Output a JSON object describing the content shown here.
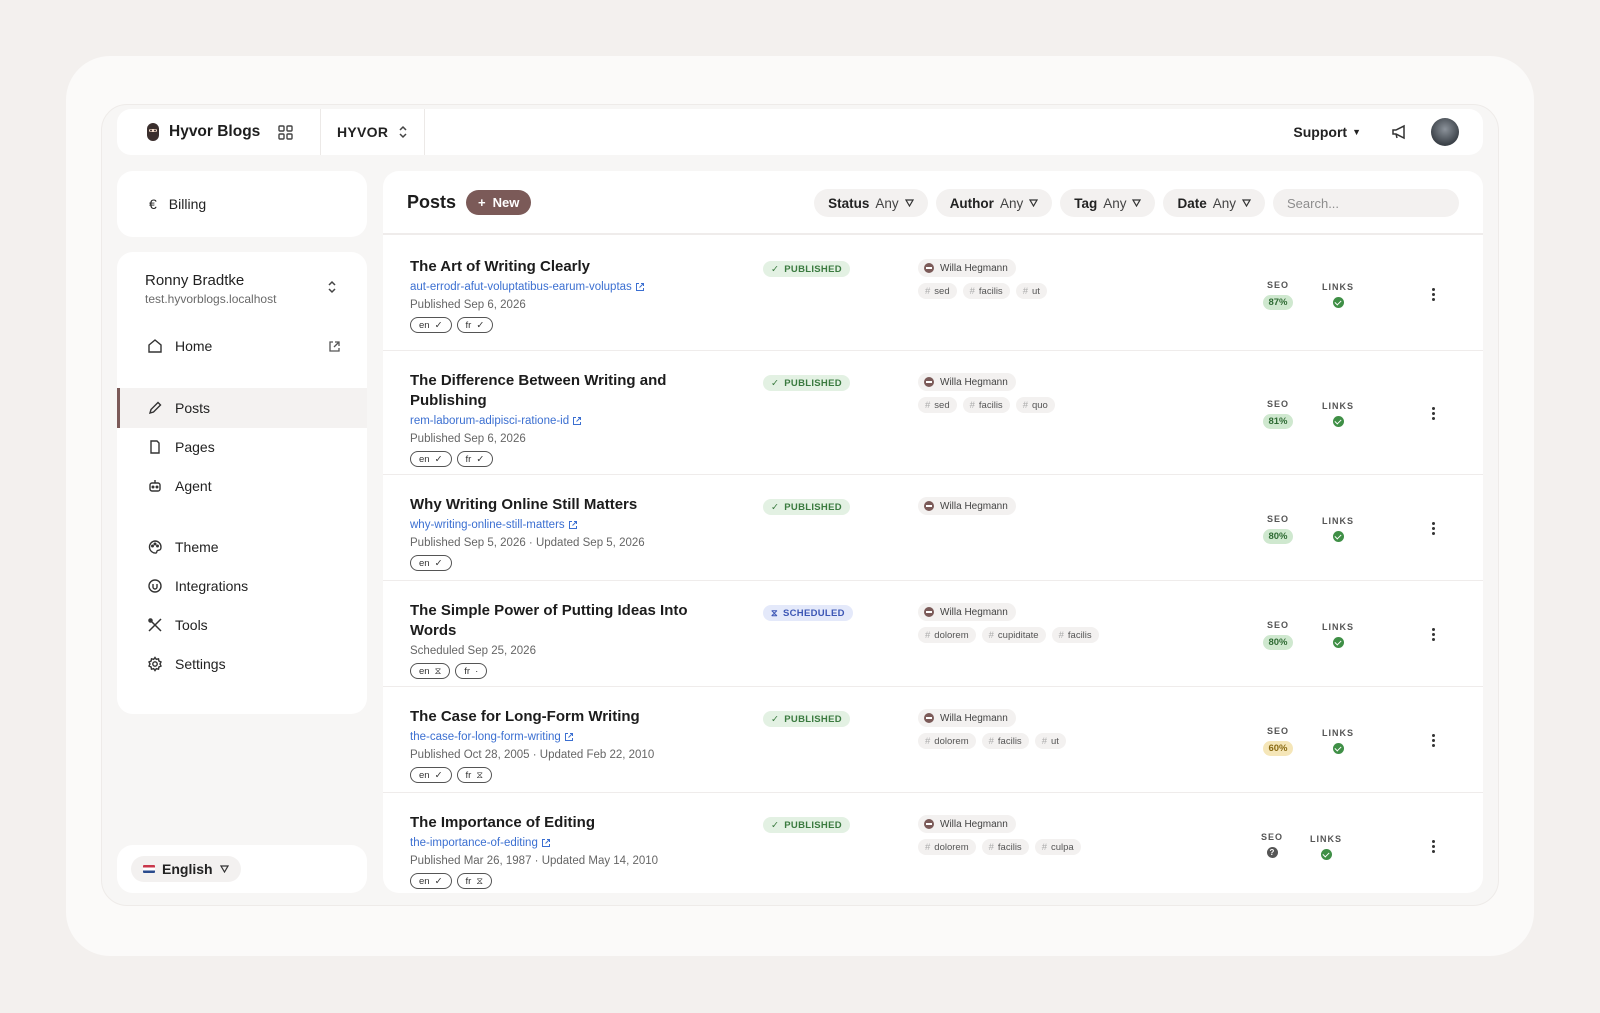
{
  "topbar": {
    "brand": "Hyvor Blogs",
    "org": "HYVOR",
    "support": "Support"
  },
  "sidebar": {
    "billing": "Billing",
    "user": {
      "name": "Ronny Bradtke",
      "host": "test.hyvorblogs.localhost"
    },
    "items": [
      {
        "label": "Home",
        "icon": "home-icon"
      },
      {
        "label": "Posts",
        "icon": "pencil-icon"
      },
      {
        "label": "Pages",
        "icon": "page-icon"
      },
      {
        "label": "Agent",
        "icon": "robot-icon"
      },
      {
        "label": "Theme",
        "icon": "palette-icon"
      },
      {
        "label": "Integrations",
        "icon": "plug-icon"
      },
      {
        "label": "Tools",
        "icon": "tools-icon"
      },
      {
        "label": "Settings",
        "icon": "gear-icon"
      }
    ],
    "language": "English"
  },
  "main": {
    "title": "Posts",
    "new_label": "New",
    "filters": [
      {
        "label": "Status",
        "value": "Any"
      },
      {
        "label": "Author",
        "value": "Any"
      },
      {
        "label": "Tag",
        "value": "Any"
      },
      {
        "label": "Date",
        "value": "Any"
      }
    ],
    "search_placeholder": "Search...",
    "seo_label": "SEO",
    "links_label": "LINKS",
    "posts": [
      {
        "title": "The Art of Writing Clearly",
        "slug": "aut-errodr-afut-voluptatibus-earum-voluptas",
        "date": "Published Sep 6, 2026",
        "langs": [
          {
            "code": "en",
            "mark": "✓"
          },
          {
            "code": "fr",
            "mark": "✓"
          }
        ],
        "status": "PUBLISHED",
        "author": "Willa Hegmann",
        "tags": [
          "sed",
          "facilis",
          "ut"
        ],
        "seo": "87%",
        "links": "ok"
      },
      {
        "title": "The Difference Between Writing and Publishing",
        "slug": "rem-laborum-adipisci-ratione-id",
        "date": "Published Sep 6, 2026",
        "langs": [
          {
            "code": "en",
            "mark": "✓"
          },
          {
            "code": "fr",
            "mark": "✓"
          }
        ],
        "status": "PUBLISHED",
        "author": "Willa Hegmann",
        "tags": [
          "sed",
          "facilis",
          "quo"
        ],
        "seo": "81%",
        "links": "ok"
      },
      {
        "title": "Why Writing Online Still Matters",
        "slug": "why-writing-online-still-matters",
        "date": "Published Sep 5, 2026 · Updated Sep 5, 2026",
        "langs": [
          {
            "code": "en",
            "mark": "✓"
          }
        ],
        "status": "PUBLISHED",
        "author": "Willa Hegmann",
        "tags": [],
        "seo": "80%",
        "links": "ok"
      },
      {
        "title": "The Simple Power of Putting Ideas Into Words",
        "slug": "",
        "date": "Scheduled Sep 25, 2026",
        "langs": [
          {
            "code": "en",
            "mark": "⧖"
          },
          {
            "code": "fr",
            "mark": "·"
          }
        ],
        "status": "SCHEDULED",
        "author": "Willa Hegmann",
        "tags": [
          "dolorem",
          "cupiditate",
          "facilis"
        ],
        "seo": "80%",
        "links": "ok"
      },
      {
        "title": "The Case for Long-Form Writing",
        "slug": "the-case-for-long-form-writing",
        "date": "Published Oct 28, 2005 · Updated Feb 22, 2010",
        "langs": [
          {
            "code": "en",
            "mark": "✓"
          },
          {
            "code": "fr",
            "mark": "⧖"
          }
        ],
        "status": "PUBLISHED",
        "author": "Willa Hegmann",
        "tags": [
          "dolorem",
          "facilis",
          "ut"
        ],
        "seo": "60%",
        "links": "ok"
      },
      {
        "title": "The Importance of Editing",
        "slug": "the-importance-of-editing",
        "date": "Published Mar 26, 1987 · Updated May 14, 2010",
        "langs": [
          {
            "code": "en",
            "mark": "✓"
          },
          {
            "code": "fr",
            "mark": "⧖"
          }
        ],
        "status": "PUBLISHED",
        "author": "Willa Hegmann",
        "tags": [
          "dolorem",
          "facilis",
          "culpa"
        ],
        "seo": "?",
        "links": "ok"
      }
    ]
  },
  "colors": {
    "accent": "#7b5a58",
    "published": "#3a7a3f",
    "scheduled": "#3d57b5",
    "link": "#3b6fd1"
  }
}
